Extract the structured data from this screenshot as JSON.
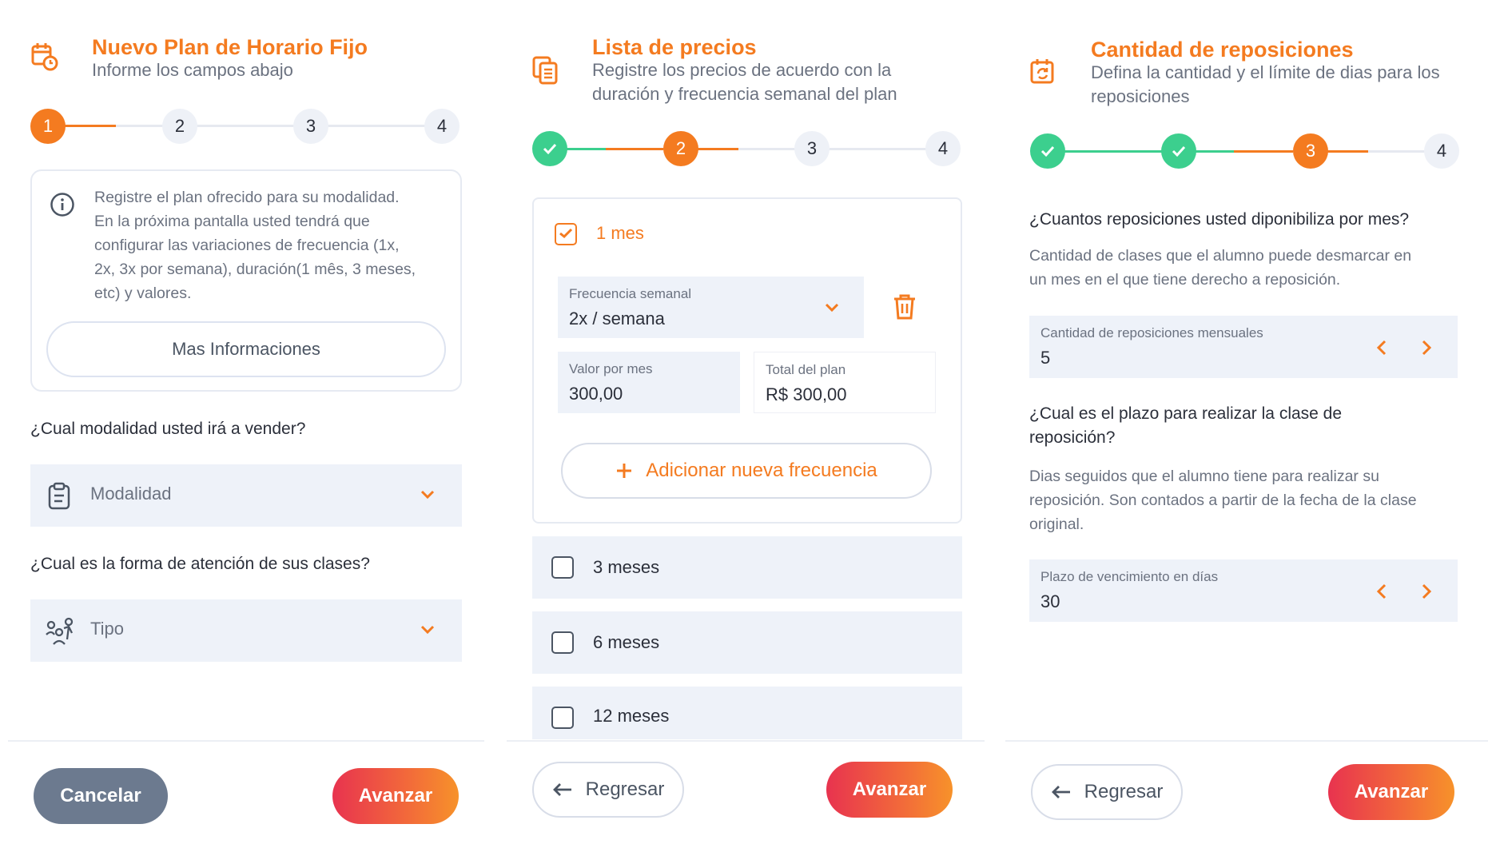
{
  "colors": {
    "accent": "#f47b20",
    "success": "#3ccf8e",
    "field_bg": "#eef2f9",
    "button_gradient": [
      "#e8334f",
      "#f7922a"
    ]
  },
  "screen1": {
    "title": "Nuevo Plan de Horario Fijo",
    "subtitle": "Informe los campos abajo",
    "steps": [
      "1",
      "2",
      "3",
      "4"
    ],
    "info_lines": [
      "Registre el plan ofrecido para su modalidad.",
      "En la próxima pantalla usted tendrá que",
      "configurar las variaciones de frecuencia (1x,",
      "2x, 3x por semana), duración(1 mês, 3 meses,",
      "etc) y valores."
    ],
    "info_button": "Mas Informaciones",
    "question_modalidad": "¿Cual modalidad usted irá a vender?",
    "modalidad_placeholder": "Modalidad",
    "question_forma": "¿Cual es la forma de atención de sus clases?",
    "tipo_placeholder": "Tipo",
    "cancel_label": "Cancelar",
    "next_label": "Avanzar"
  },
  "screen2": {
    "title": "Lista de precios",
    "subtitle_lines": [
      "Registre los precios de acuerdo con la",
      "duración y frecuencia semanal del plan"
    ],
    "steps": [
      "2",
      "3",
      "4"
    ],
    "option_1": "1 mes",
    "freq_label": "Frecuencia semanal",
    "freq_value": "2x / semana",
    "valor_label": "Valor por mes",
    "valor_value": "300,00",
    "total_label": "Total del plan",
    "total_value": "R$ 300,00",
    "add_frequency": "Adicionar nueva frecuencia",
    "options": [
      "3 meses",
      "6 meses",
      "12 meses"
    ],
    "back_label": "Regresar",
    "next_label": "Avanzar"
  },
  "screen3": {
    "title": "Cantidad de reposiciones",
    "subtitle_lines": [
      "Defina la cantidad y el límite de dias para los",
      "reposiciones"
    ],
    "steps": [
      "3",
      "4"
    ],
    "q1": "¿Cuantos reposiciones usted diponibiliza por mes?",
    "d1_lines": [
      "Cantidad de clases que el alumno puede desmarcar en",
      "un mes en el que tiene derecho a reposición."
    ],
    "field1_label": "Cantidad de reposiciones  mensuales",
    "field1_value": "5",
    "q2_lines": [
      "¿Cual es el plazo para realizar la clase de",
      "reposición?"
    ],
    "d2_lines": [
      "Dias seguidos que el alumno tiene para realizar su",
      "reposición. Son contados a partir de la fecha de la clase",
      "original."
    ],
    "field2_label": "Plazo de vencimiento en días",
    "field2_value": "30",
    "back_label": "Regresar",
    "next_label": "Avanzar"
  }
}
